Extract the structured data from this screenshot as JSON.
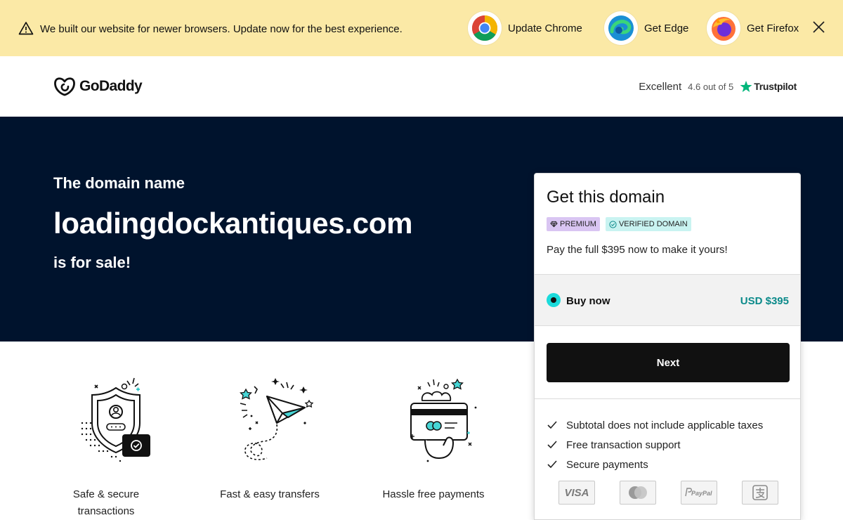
{
  "banner": {
    "message": "We built our website for newer browsers. Update now for the best experience.",
    "browsers": [
      {
        "label": "Update Chrome",
        "icon": "chrome-icon"
      },
      {
        "label": "Get Edge",
        "icon": "edge-icon"
      },
      {
        "label": "Get Firefox",
        "icon": "firefox-icon"
      }
    ],
    "close_icon": "close-icon"
  },
  "header": {
    "logo_text": "GoDaddy",
    "trust_rating": "Excellent",
    "trust_score": "4.6 out of 5",
    "trust_brand": "Trustpilot"
  },
  "hero": {
    "line1": "The domain name",
    "domain": "loadingdockantiques.com",
    "line3": "is for sale!"
  },
  "features": [
    {
      "label": "Safe & secure transactions",
      "icon": "shield-icon"
    },
    {
      "label": "Fast & easy transfers",
      "icon": "paper-plane-icon"
    },
    {
      "label": "Hassle free payments",
      "icon": "payment-hand-icon"
    }
  ],
  "card": {
    "title": "Get this domain",
    "badges": [
      "PREMIUM",
      "VERIFIED DOMAIN"
    ],
    "pay_text": "Pay the full $395 now to make it yours!",
    "option_label": "Buy now",
    "option_price": "USD $395",
    "next_label": "Next",
    "bullets": [
      "Subtotal does not include applicable taxes",
      "Free transaction support",
      "Secure payments"
    ],
    "payment_methods": [
      "visa-icon",
      "mastercard-icon",
      "paypal-icon",
      "alipay-icon"
    ]
  },
  "colors": {
    "banner_bg": "#fbe9a6",
    "hero_bg": "#00132d",
    "accent_teal": "#1bdbdb",
    "price_teal": "#0b8a8a",
    "premium_badge": "#d9c5f2",
    "verified_badge": "#c9f3f1"
  }
}
